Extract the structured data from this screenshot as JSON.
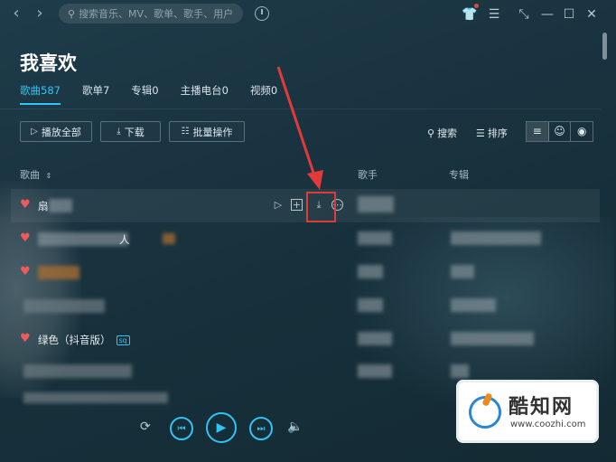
{
  "topbar": {
    "search_placeholder": "搜索音乐、MV、歌单、歌手、用户",
    "icons": [
      "back-arrow-icon",
      "forward-arrow-icon",
      "history-icon",
      "skin-icon",
      "menu-icon",
      "mini-mode-icon",
      "minimize-icon",
      "maximize-icon",
      "close-icon"
    ]
  },
  "page": {
    "title": "我喜欢",
    "tabs": [
      {
        "label": "歌曲587",
        "active": true
      },
      {
        "label": "歌单7",
        "active": false
      },
      {
        "label": "专辑0",
        "active": false
      },
      {
        "label": "主播电台0",
        "active": false
      },
      {
        "label": "视频0",
        "active": false
      }
    ]
  },
  "toolbar": {
    "play_all": "播放全部",
    "download": "下载",
    "batch": "批量操作",
    "search": "搜索",
    "sort": "排序"
  },
  "columns": {
    "song": "歌曲",
    "artist": "歌手",
    "album": "专辑"
  },
  "songs": [
    {
      "name": "扇",
      "liked": true
    },
    {
      "name": "人",
      "liked": true
    },
    {
      "name": "",
      "liked": true
    },
    {
      "name": "",
      "liked": false
    },
    {
      "name": "绿色（抖音版）",
      "liked": true,
      "badge": "sq"
    },
    {
      "name": "",
      "liked": false
    },
    {
      "name": "",
      "liked": false
    }
  ],
  "colors": {
    "accent": "#31c3f2",
    "heart": "#ef5a5a",
    "highlight_box": "#e23a3a"
  },
  "watermark": {
    "text": "酷知网",
    "url": "www.coozhi.com"
  }
}
